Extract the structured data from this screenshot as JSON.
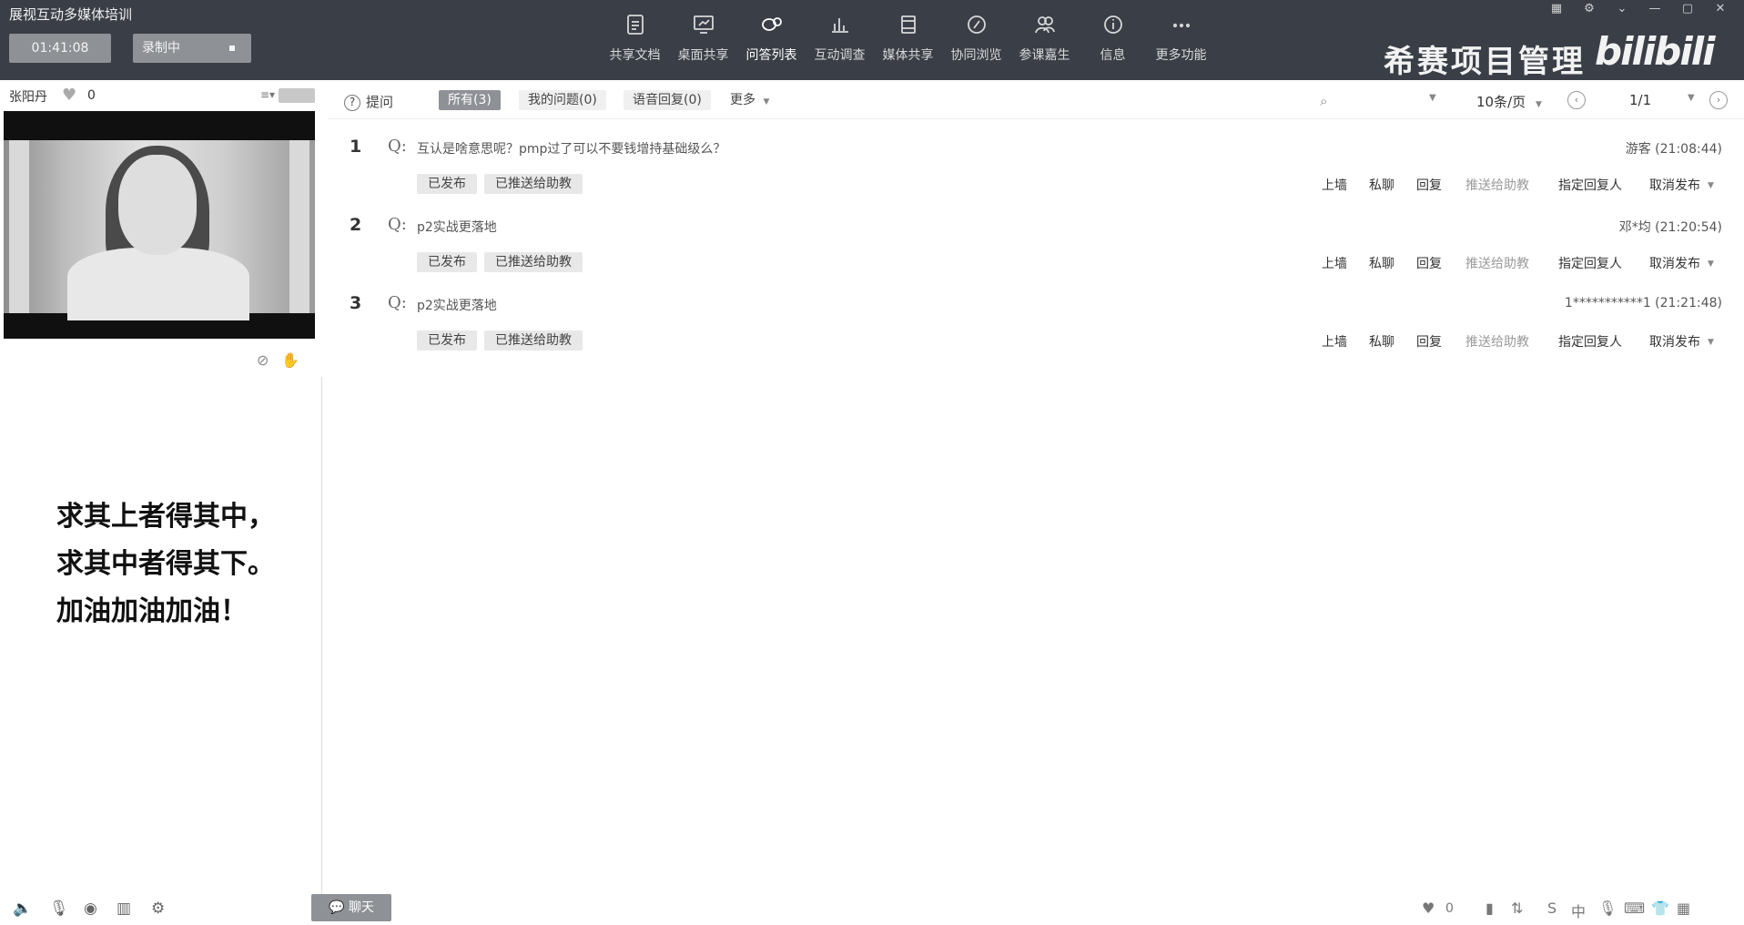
{
  "app": {
    "title": "展视互动多媒体培训"
  },
  "header": {
    "timer_label": "01:41:08",
    "record_label": "录制中",
    "tools": [
      {
        "label": "共享文档",
        "icon": "document-icon"
      },
      {
        "label": "桌面共享",
        "icon": "desktop-share-icon"
      },
      {
        "label": "问答列表",
        "icon": "qa-list-icon",
        "active": true
      },
      {
        "label": "互动调查",
        "icon": "survey-chart-icon"
      },
      {
        "label": "媒体共享",
        "icon": "media-share-icon"
      },
      {
        "label": "协同浏览",
        "icon": "co-browse-icon"
      },
      {
        "label": "参课嘉生",
        "icon": "participants-icon"
      },
      {
        "label": "信息",
        "icon": "info-icon"
      },
      {
        "label": "更多功能",
        "icon": "more-icon"
      }
    ],
    "brand": "希赛项目管理",
    "watermark": "bilibili"
  },
  "presenter": {
    "name": "张阳丹",
    "likes": "0"
  },
  "slogan": {
    "line1": "求其上者得其中，",
    "line2": "求其中者得其下。",
    "line3": "加油加油加油！"
  },
  "chat": {
    "label": "聊天"
  },
  "qa": {
    "ask_label": "提问",
    "filters": [
      {
        "label": "所有(3)",
        "active": true
      },
      {
        "label": "我的问题(0)"
      },
      {
        "label": "语音回复(0)"
      },
      {
        "label": "更多"
      }
    ],
    "per_page": "10条/页",
    "page": "1/1",
    "question_prefix": "Q:",
    "tags": {
      "published": "已发布",
      "pushed": "已推送给助教"
    },
    "actions": {
      "wall": "上墙",
      "private": "私聊",
      "reply": "回复",
      "push": "推送给助教",
      "assign": "指定回复人",
      "unpublish": "取消发布"
    },
    "items": [
      {
        "num": "1",
        "text": "互认是啥意思呢？pmp过了可以不要钱增持基础级么？",
        "meta": "游客 (21:08:44)"
      },
      {
        "num": "2",
        "text": "p2实战更落地",
        "meta": "邓*均 (21:20:54)"
      },
      {
        "num": "3",
        "text": "p2实战更落地",
        "meta": "1***********1 (21:21:48)"
      }
    ]
  },
  "status": {
    "likes": "0"
  }
}
